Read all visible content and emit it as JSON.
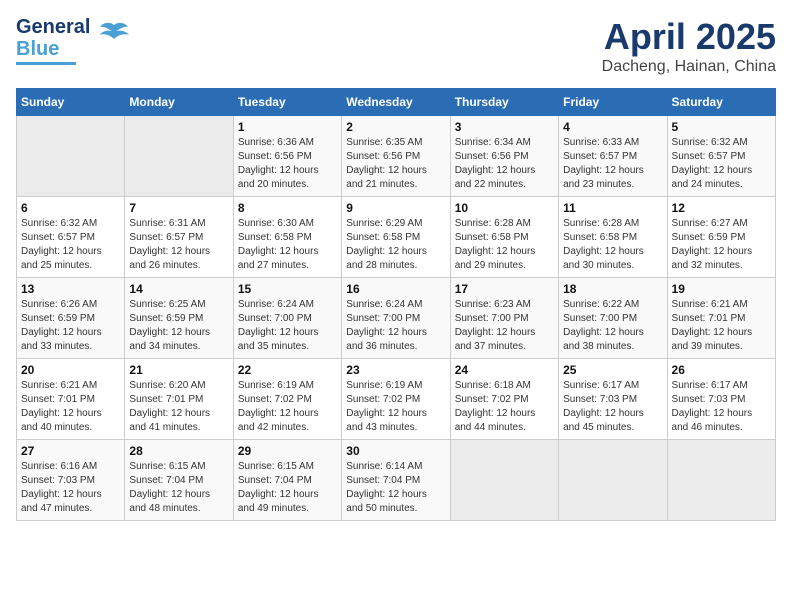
{
  "header": {
    "logo_line1": "General",
    "logo_line2": "Blue",
    "title": "April 2025",
    "subtitle": "Dacheng, Hainan, China"
  },
  "weekdays": [
    "Sunday",
    "Monday",
    "Tuesday",
    "Wednesday",
    "Thursday",
    "Friday",
    "Saturday"
  ],
  "weeks": [
    [
      {
        "day": "",
        "sunrise": "",
        "sunset": "",
        "daylight": ""
      },
      {
        "day": "",
        "sunrise": "",
        "sunset": "",
        "daylight": ""
      },
      {
        "day": "1",
        "sunrise": "Sunrise: 6:36 AM",
        "sunset": "Sunset: 6:56 PM",
        "daylight": "Daylight: 12 hours and 20 minutes."
      },
      {
        "day": "2",
        "sunrise": "Sunrise: 6:35 AM",
        "sunset": "Sunset: 6:56 PM",
        "daylight": "Daylight: 12 hours and 21 minutes."
      },
      {
        "day": "3",
        "sunrise": "Sunrise: 6:34 AM",
        "sunset": "Sunset: 6:56 PM",
        "daylight": "Daylight: 12 hours and 22 minutes."
      },
      {
        "day": "4",
        "sunrise": "Sunrise: 6:33 AM",
        "sunset": "Sunset: 6:57 PM",
        "daylight": "Daylight: 12 hours and 23 minutes."
      },
      {
        "day": "5",
        "sunrise": "Sunrise: 6:32 AM",
        "sunset": "Sunset: 6:57 PM",
        "daylight": "Daylight: 12 hours and 24 minutes."
      }
    ],
    [
      {
        "day": "6",
        "sunrise": "Sunrise: 6:32 AM",
        "sunset": "Sunset: 6:57 PM",
        "daylight": "Daylight: 12 hours and 25 minutes."
      },
      {
        "day": "7",
        "sunrise": "Sunrise: 6:31 AM",
        "sunset": "Sunset: 6:57 PM",
        "daylight": "Daylight: 12 hours and 26 minutes."
      },
      {
        "day": "8",
        "sunrise": "Sunrise: 6:30 AM",
        "sunset": "Sunset: 6:58 PM",
        "daylight": "Daylight: 12 hours and 27 minutes."
      },
      {
        "day": "9",
        "sunrise": "Sunrise: 6:29 AM",
        "sunset": "Sunset: 6:58 PM",
        "daylight": "Daylight: 12 hours and 28 minutes."
      },
      {
        "day": "10",
        "sunrise": "Sunrise: 6:28 AM",
        "sunset": "Sunset: 6:58 PM",
        "daylight": "Daylight: 12 hours and 29 minutes."
      },
      {
        "day": "11",
        "sunrise": "Sunrise: 6:28 AM",
        "sunset": "Sunset: 6:58 PM",
        "daylight": "Daylight: 12 hours and 30 minutes."
      },
      {
        "day": "12",
        "sunrise": "Sunrise: 6:27 AM",
        "sunset": "Sunset: 6:59 PM",
        "daylight": "Daylight: 12 hours and 32 minutes."
      }
    ],
    [
      {
        "day": "13",
        "sunrise": "Sunrise: 6:26 AM",
        "sunset": "Sunset: 6:59 PM",
        "daylight": "Daylight: 12 hours and 33 minutes."
      },
      {
        "day": "14",
        "sunrise": "Sunrise: 6:25 AM",
        "sunset": "Sunset: 6:59 PM",
        "daylight": "Daylight: 12 hours and 34 minutes."
      },
      {
        "day": "15",
        "sunrise": "Sunrise: 6:24 AM",
        "sunset": "Sunset: 7:00 PM",
        "daylight": "Daylight: 12 hours and 35 minutes."
      },
      {
        "day": "16",
        "sunrise": "Sunrise: 6:24 AM",
        "sunset": "Sunset: 7:00 PM",
        "daylight": "Daylight: 12 hours and 36 minutes."
      },
      {
        "day": "17",
        "sunrise": "Sunrise: 6:23 AM",
        "sunset": "Sunset: 7:00 PM",
        "daylight": "Daylight: 12 hours and 37 minutes."
      },
      {
        "day": "18",
        "sunrise": "Sunrise: 6:22 AM",
        "sunset": "Sunset: 7:00 PM",
        "daylight": "Daylight: 12 hours and 38 minutes."
      },
      {
        "day": "19",
        "sunrise": "Sunrise: 6:21 AM",
        "sunset": "Sunset: 7:01 PM",
        "daylight": "Daylight: 12 hours and 39 minutes."
      }
    ],
    [
      {
        "day": "20",
        "sunrise": "Sunrise: 6:21 AM",
        "sunset": "Sunset: 7:01 PM",
        "daylight": "Daylight: 12 hours and 40 minutes."
      },
      {
        "day": "21",
        "sunrise": "Sunrise: 6:20 AM",
        "sunset": "Sunset: 7:01 PM",
        "daylight": "Daylight: 12 hours and 41 minutes."
      },
      {
        "day": "22",
        "sunrise": "Sunrise: 6:19 AM",
        "sunset": "Sunset: 7:02 PM",
        "daylight": "Daylight: 12 hours and 42 minutes."
      },
      {
        "day": "23",
        "sunrise": "Sunrise: 6:19 AM",
        "sunset": "Sunset: 7:02 PM",
        "daylight": "Daylight: 12 hours and 43 minutes."
      },
      {
        "day": "24",
        "sunrise": "Sunrise: 6:18 AM",
        "sunset": "Sunset: 7:02 PM",
        "daylight": "Daylight: 12 hours and 44 minutes."
      },
      {
        "day": "25",
        "sunrise": "Sunrise: 6:17 AM",
        "sunset": "Sunset: 7:03 PM",
        "daylight": "Daylight: 12 hours and 45 minutes."
      },
      {
        "day": "26",
        "sunrise": "Sunrise: 6:17 AM",
        "sunset": "Sunset: 7:03 PM",
        "daylight": "Daylight: 12 hours and 46 minutes."
      }
    ],
    [
      {
        "day": "27",
        "sunrise": "Sunrise: 6:16 AM",
        "sunset": "Sunset: 7:03 PM",
        "daylight": "Daylight: 12 hours and 47 minutes."
      },
      {
        "day": "28",
        "sunrise": "Sunrise: 6:15 AM",
        "sunset": "Sunset: 7:04 PM",
        "daylight": "Daylight: 12 hours and 48 minutes."
      },
      {
        "day": "29",
        "sunrise": "Sunrise: 6:15 AM",
        "sunset": "Sunset: 7:04 PM",
        "daylight": "Daylight: 12 hours and 49 minutes."
      },
      {
        "day": "30",
        "sunrise": "Sunrise: 6:14 AM",
        "sunset": "Sunset: 7:04 PM",
        "daylight": "Daylight: 12 hours and 50 minutes."
      },
      {
        "day": "",
        "sunrise": "",
        "sunset": "",
        "daylight": ""
      },
      {
        "day": "",
        "sunrise": "",
        "sunset": "",
        "daylight": ""
      },
      {
        "day": "",
        "sunrise": "",
        "sunset": "",
        "daylight": ""
      }
    ]
  ]
}
